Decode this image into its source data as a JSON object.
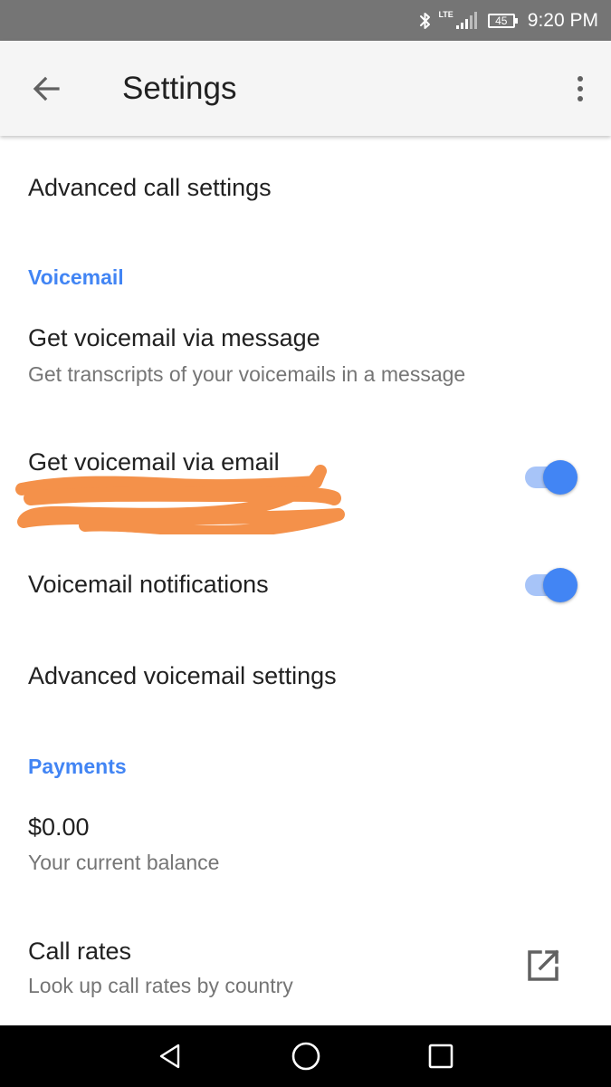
{
  "status_bar": {
    "network": "LTE",
    "battery": "45",
    "time": "9:20 PM",
    "icons": [
      "bluetooth-icon",
      "lte-signal-icon",
      "battery-icon"
    ]
  },
  "app_bar": {
    "title": "Settings",
    "back_icon": "arrow-back-icon",
    "menu_icon": "more-vert-icon"
  },
  "settings": {
    "advanced_call": {
      "title": "Advanced call settings"
    },
    "voicemail_header": "Voicemail",
    "voicemail_message": {
      "title": "Get voicemail via message",
      "subtitle": "Get transcripts of your voicemails in a message"
    },
    "voicemail_email": {
      "title": "Get voicemail via email",
      "subtitle_redacted": true,
      "enabled": true
    },
    "voicemail_notifications": {
      "title": "Voicemail notifications",
      "enabled": true
    },
    "advanced_voicemail": {
      "title": "Advanced voicemail settings"
    },
    "payments_header": "Payments",
    "balance": {
      "title": "$0.00",
      "subtitle": "Your current balance"
    },
    "call_rates": {
      "title": "Call rates",
      "subtitle": "Look up call rates by country",
      "icon": "open-in-new-icon"
    }
  },
  "nav_bar": {
    "icons": [
      "back-triangle-icon",
      "home-circle-icon",
      "recents-square-icon"
    ]
  },
  "colors": {
    "accent": "#4285f4",
    "status_bar": "#757575",
    "app_bar": "#f5f5f5",
    "redaction": "#f4914a"
  }
}
